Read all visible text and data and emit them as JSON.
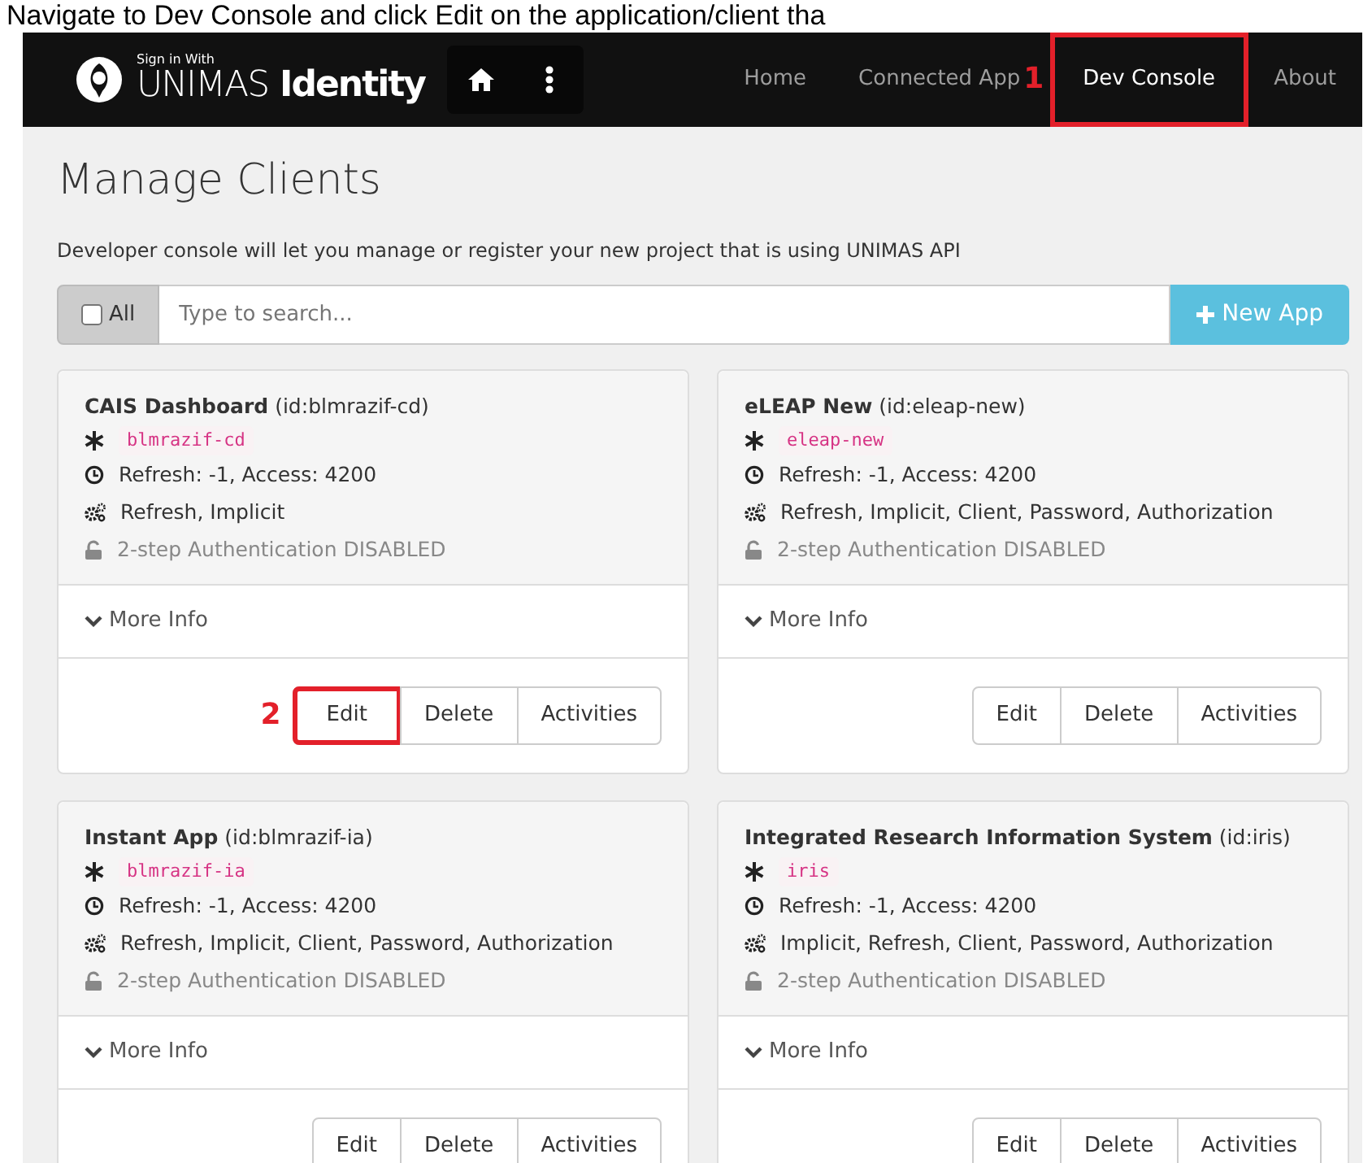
{
  "caption": "Navigate to Dev Console and click Edit on the application/client tha",
  "brand": {
    "small": "Sign in With",
    "name_light": "UNIMAS",
    "name_bold": "Identity"
  },
  "nav": [
    {
      "label": "Home",
      "selected": false
    },
    {
      "label": "Connected App",
      "selected": false
    },
    {
      "label": "Dev Console",
      "selected": true,
      "callout": "1"
    },
    {
      "label": "About",
      "selected": false
    }
  ],
  "page": {
    "title": "Manage Clients",
    "description": "Developer console will let you manage or register your new project that is using UNIMAS API"
  },
  "toolbar": {
    "select_all": {
      "label": "All",
      "checked": false
    },
    "search": {
      "placeholder": "Type to search..."
    },
    "new_button": "New App"
  },
  "clients": [
    {
      "name": "CAIS Dashboard",
      "id": "(id:blmrazif-cd)",
      "client_id": "blmrazif-cd",
      "tokens": "Refresh: -1, Access: 4200",
      "grants": "Refresh, Implicit",
      "two_step": "2-step Authentication DISABLED",
      "two_step_enabled": false,
      "more": "More Info",
      "actions": [
        {
          "label": "Edit",
          "callout": "2"
        },
        {
          "label": "Delete"
        },
        {
          "label": "Activities"
        }
      ]
    },
    {
      "name": "eLEAP New",
      "id": "(id:eleap-new)",
      "client_id": "eleap-new",
      "tokens": "Refresh: -1, Access: 4200",
      "grants": "Refresh, Implicit, Client, Password, Authorization",
      "two_step": "2-step Authentication DISABLED",
      "two_step_enabled": false,
      "more": "More Info",
      "actions": [
        {
          "label": "Edit"
        },
        {
          "label": "Delete"
        },
        {
          "label": "Activities"
        }
      ]
    },
    {
      "name": "Instant App",
      "id": "(id:blmrazif-ia)",
      "client_id": "blmrazif-ia",
      "tokens": "Refresh: -1, Access: 4200",
      "grants": "Refresh, Implicit, Client, Password, Authorization",
      "two_step": "2-step Authentication DISABLED",
      "two_step_enabled": false,
      "more": "More Info",
      "actions": [
        {
          "label": "Edit"
        },
        {
          "label": "Delete"
        },
        {
          "label": "Activities"
        }
      ]
    },
    {
      "name": "Integrated Research Information System",
      "id": "(id:iris)",
      "client_id": "iris",
      "tokens": "Refresh: -1, Access: 4200",
      "grants": "Implicit, Refresh, Client, Password, Authorization",
      "two_step": "2-step Authentication DISABLED",
      "two_step_enabled": false,
      "more": "More Info",
      "actions": [
        {
          "label": "Edit"
        },
        {
          "label": "Delete"
        },
        {
          "label": "Activities"
        }
      ]
    }
  ]
}
